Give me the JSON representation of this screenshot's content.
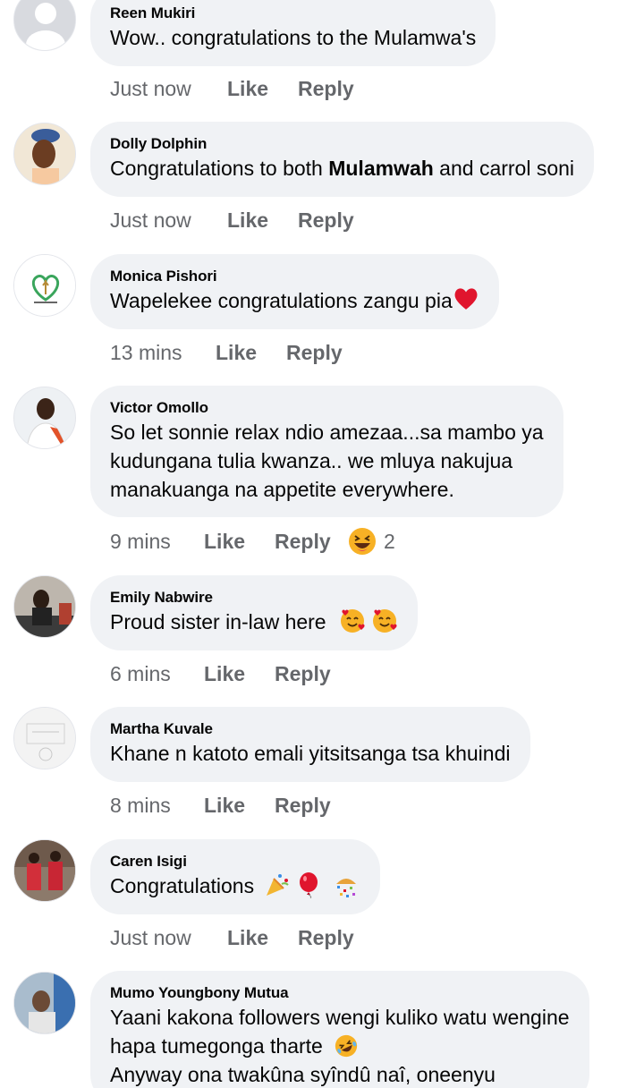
{
  "comments": [
    {
      "name": "Reen Mukiri",
      "text": "Wow.. congratulations to the Mulamwa's",
      "time": "Just now",
      "like": "Like",
      "reply": "Reply"
    },
    {
      "name": "Dolly Dolphin",
      "text_pre": "Congratulations to both ",
      "text_bold": "Mulamwah",
      "text_post": " and carrol soni",
      "time": "Just now",
      "like": "Like",
      "reply": "Reply"
    },
    {
      "name": "Monica Pishori",
      "text": "Wapelekee congratulations zangu pia",
      "emoji": "red-heart",
      "time": "13 mins",
      "like": "Like",
      "reply": "Reply"
    },
    {
      "name": "Victor Omollo",
      "lines": [
        "So let sonnie relax ndio amezaa...sa mambo ya",
        "kudungana tulia kwanza.. we mluya nakujua",
        "manakuanga na appetite everywhere."
      ],
      "time": "9 mins",
      "like": "Like",
      "reply": "Reply",
      "reaction_icon": "laughing-face",
      "reaction_count": "2"
    },
    {
      "name": "Emily Nabwire",
      "text": "Proud sister in-law here",
      "emoji": "smiling-face-with-hearts x2",
      "time": "6 mins",
      "like": "Like",
      "reply": "Reply"
    },
    {
      "name": "Martha Kuvale",
      "text": "Khane n katoto emali yitsitsanga tsa khuindi",
      "time": "8 mins",
      "like": "Like",
      "reply": "Reply"
    },
    {
      "name": "Caren Isigi",
      "text": "Congratulations",
      "emoji": "party-popper balloon confetti",
      "time": "Just now",
      "like": "Like",
      "reply": "Reply"
    },
    {
      "name": "Mumo Youngbony Mutua",
      "lines": [
        "Yaani kakona followers wengi kuliko watu wengine",
        "hapa tumegonga tharte",
        "Anyway ona twakûna syîndû naî, oneenyu"
      ],
      "emoji": "rolling-laughing-face"
    }
  ]
}
